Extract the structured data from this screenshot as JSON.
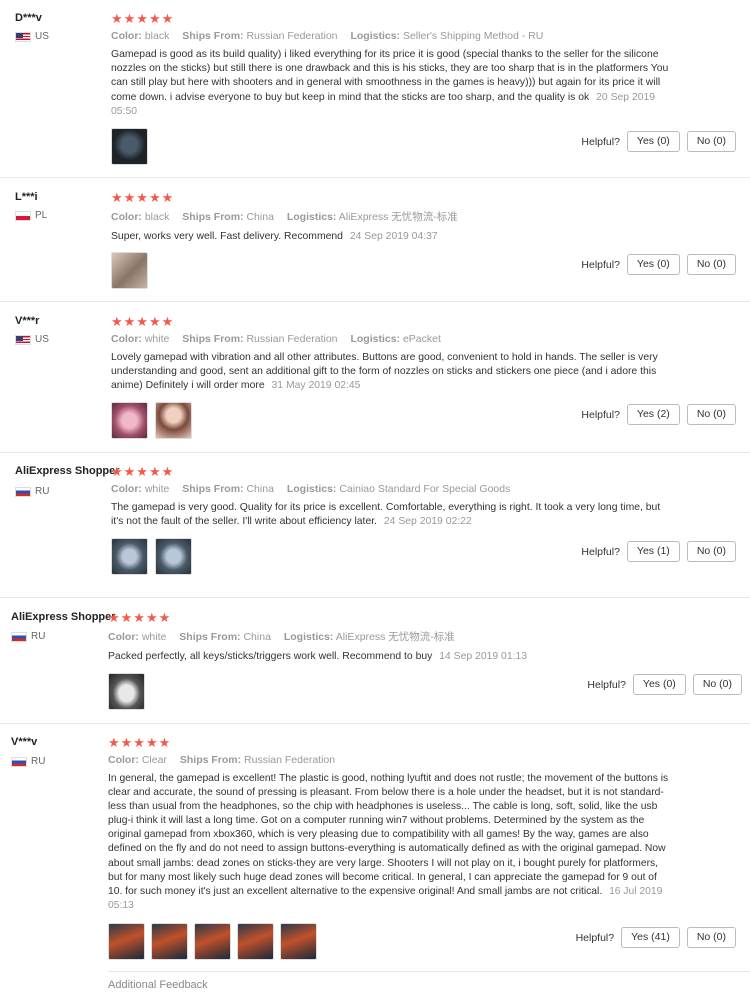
{
  "reviews": [
    {
      "user": "D***v",
      "country": "US",
      "stars": "★★★★★",
      "meta": {
        "color_label": "Color:",
        "color": "black",
        "ships_label": "Ships From:",
        "ships": "Russian Federation",
        "logistics_label": "Logistics:",
        "logistics": "Seller's Shipping Method - RU"
      },
      "text": "Gamepad is good as its build quality) i liked everything for its price it is good (special thanks to the seller for the silicone nozzles on the sticks) but still there is one drawback and this is his sticks, they are too sharp that is in the platformers You can still play but here with shooters and in general with smoothness in the games is heavy))) but again for its price it will come down. i advise everyone to buy but keep in mind that the sticks are too sharp, and the quality is ok",
      "date": "20 Sep 2019 05:50",
      "helpful_label": "Helpful?",
      "yes": "Yes (0)",
      "no": "No (0)"
    },
    {
      "user": "L***i",
      "country": "PL",
      "stars": "★★★★★",
      "meta": {
        "color_label": "Color:",
        "color": "black",
        "ships_label": "Ships From:",
        "ships": "China",
        "logistics_label": "Logistics:",
        "logistics": "AliExpress 无忧物流-标准"
      },
      "text": "Super, works very well. Fast delivery. Recommend",
      "date": "24 Sep 2019 04:37",
      "helpful_label": "Helpful?",
      "yes": "Yes (0)",
      "no": "No (0)"
    },
    {
      "user": "V***r",
      "country": "US",
      "stars": "★★★★★",
      "meta": {
        "color_label": "Color:",
        "color": "white",
        "ships_label": "Ships From:",
        "ships": "Russian Federation",
        "logistics_label": "Logistics:",
        "logistics": "ePacket"
      },
      "text": "Lovely gamepad with vibration and all other attributes. Buttons are good, convenient to hold in hands. The seller is very understanding and good, sent an additional gift to the form of nozzles on sticks and stickers one piece (and i adore this anime) Definitely i will order more",
      "date": "31 May 2019 02:45",
      "helpful_label": "Helpful?",
      "yes": "Yes (2)",
      "no": "No (0)"
    },
    {
      "user": "AliExpress Shopper",
      "country": "RU",
      "stars": "★★★★★",
      "meta": {
        "color_label": "Color:",
        "color": "white",
        "ships_label": "Ships From:",
        "ships": "China",
        "logistics_label": "Logistics:",
        "logistics": "Cainiao Standard For Special Goods"
      },
      "text": "The gamepad is very good. Quality for its price is excellent. Comfortable, everything is right. It took a very long time, but it's not the fault of the seller. I'll write about efficiency later.",
      "date": "24 Sep 2019 02:22",
      "helpful_label": "Helpful?",
      "yes": "Yes (1)",
      "no": "No (0)"
    },
    {
      "user": "AliExpress Shopper",
      "country": "RU",
      "stars": "★★★★★",
      "meta": {
        "color_label": "Color:",
        "color": "white",
        "ships_label": "Ships From:",
        "ships": "China",
        "logistics_label": "Logistics:",
        "logistics": "AliExpress 无忧物流-标准"
      },
      "text": "Packed perfectly, all keys/sticks/triggers work well. Recommend to buy",
      "date": "14 Sep 2019 01:13",
      "helpful_label": "Helpful?",
      "yes": "Yes (0)",
      "no": "No (0)"
    },
    {
      "user": "V***v",
      "country": "RU",
      "stars": "★★★★★",
      "meta": {
        "color_label": "Color:",
        "color": "Clear",
        "ships_label": "Ships From:",
        "ships": "Russian Federation"
      },
      "text": "In general, the gamepad is excellent! The plastic is good, nothing lyuftit and does not rustle; the movement of the buttons is clear and accurate, the sound of pressing is pleasant. From below there is a hole under the headset, but it is not standard-less than usual from the headphones, so the chip with headphones is useless... The cable is long, soft, solid, like the usb plug-i think it will last a long time. Got on a computer running win7 without problems. Determined by the system as the original gamepad from xbox360, which is very pleasing due to compatibility with all games! By the way, games are also defined on the fly and do not need to assign buttons-everything is automatically defined as with the original gamepad. Now about small jambs: dead zones on sticks-they are very large. Shooters I will not play on it, i bought purely for platformers, but for many most likely such huge dead zones will become critical. In general, I can appreciate the gamepad for 9 out of 10. for such money it's just an excellent alternative to the expensive original! And small jambs are not critical.",
      "date": "16 Jul 2019 05:13",
      "helpful_label": "Helpful?",
      "yes": "Yes (41)",
      "no": "No (0)"
    }
  ],
  "additional_feedback": "Additional Feedback"
}
